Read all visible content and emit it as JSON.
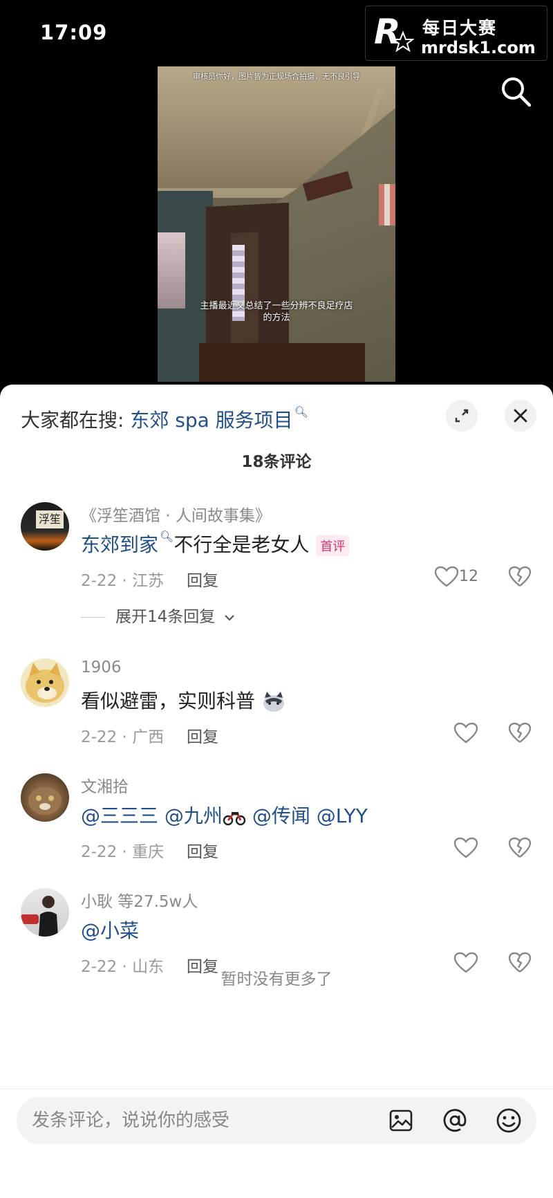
{
  "status_bar": {
    "time": "17:09"
  },
  "watermark": {
    "brand_cn": "每日大赛",
    "url": "mrdsk1.com",
    "logo_letter": "R",
    "logo_small": "每日大赛"
  },
  "video": {
    "notice": "审核员你好，图片皆为正规场合拍摄，无不良引导",
    "subtitle_line1": "主播最近又总结了一些分辨不良足疗店",
    "subtitle_line2": "的方法"
  },
  "hot_search": {
    "prefix": "大家都在搜:",
    "query": "东郊 spa 服务项目"
  },
  "comments_header": {
    "count_label": "18条评论"
  },
  "comments": [
    {
      "username": "《浮笙酒馆 · 人间故事集》",
      "avatar_text": "浮笙",
      "mention": "东郊到家",
      "text": "不行全是老女人",
      "badge": "首评",
      "date_location": "2-22 · 江苏",
      "reply_label": "回复",
      "like_count": "12",
      "expand_label": "展开14条回复"
    },
    {
      "username": "1906",
      "text": "看似避雷，实则科普",
      "date_location": "2-22 · 广西",
      "reply_label": "回复"
    },
    {
      "username": "文湘拾",
      "mentions": [
        "@三三三",
        "@九州",
        "@传闻",
        "@LYY"
      ],
      "date_location": "2-22 · 重庆",
      "reply_label": "回复"
    },
    {
      "username": "小耿  等27.5w人",
      "mention": "@小菜",
      "date_location": "2-22 · 山东",
      "reply_label": "回复"
    }
  ],
  "footer": {
    "no_more": "暂时没有更多了"
  },
  "input_bar": {
    "placeholder": "发条评论，说说你的感受"
  },
  "icons": {
    "search": "search-icon",
    "expand": "expand-icon",
    "close": "close-icon",
    "heart": "heart-icon",
    "broken_heart": "broken-heart-icon",
    "image": "image-icon",
    "at": "at-icon",
    "emoji": "emoji-icon",
    "chevron": "chevron-down-icon",
    "motorbike": "motorbike-emoji"
  },
  "colors": {
    "link": "#1f4f8a",
    "badge": "#e0306a",
    "sheet": "#ffffff"
  }
}
